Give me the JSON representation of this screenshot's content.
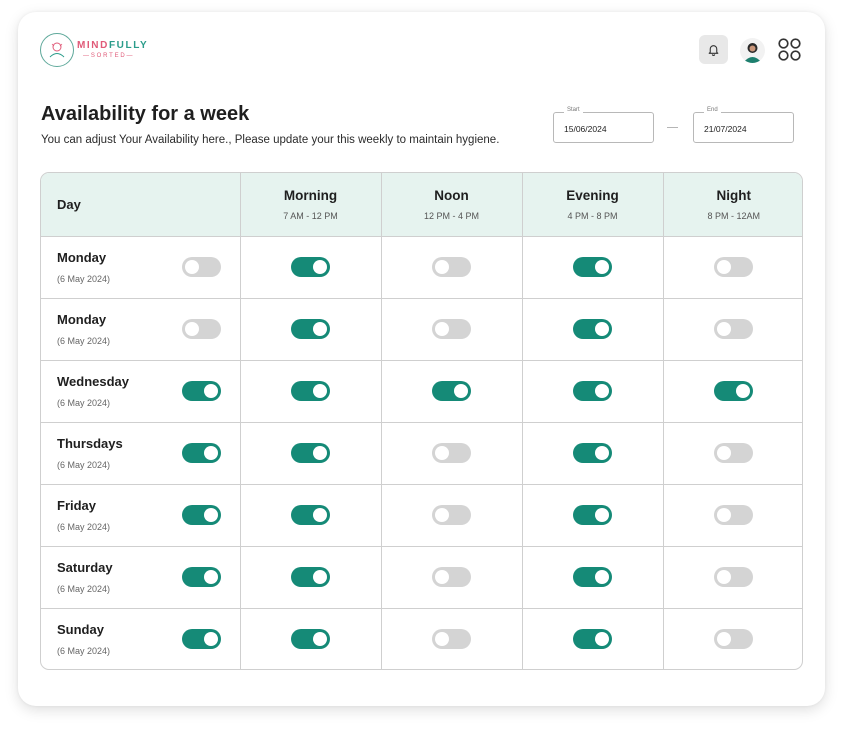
{
  "brand": {
    "name_part1": "MIND",
    "name_part2": "FULLY",
    "tagline": "SORTED"
  },
  "header": {
    "icons": [
      "bell-icon",
      "user-avatar",
      "apps-grid-icon"
    ]
  },
  "page": {
    "title": "Availability for a week",
    "subtitle": "You can adjust Your Availability here., Please update your this weekly to maintain hygiene."
  },
  "date_range": {
    "start_label": "Start",
    "start_value": "15/06/2024",
    "end_label": "End",
    "end_value": "21/07/2024"
  },
  "table": {
    "day_header": "Day",
    "slots": [
      {
        "name": "Morning",
        "time": "7 AM - 12 PM"
      },
      {
        "name": "Noon",
        "time": "12 PM - 4 PM"
      },
      {
        "name": "Evening",
        "time": "4 PM - 8 PM"
      },
      {
        "name": "Night",
        "time": "8 PM - 12AM"
      }
    ],
    "rows": [
      {
        "day": "Monday",
        "date": "(6 May 2024)",
        "day_on": false,
        "slots_on": [
          true,
          false,
          true,
          false
        ]
      },
      {
        "day": "Monday",
        "date": "(6 May 2024)",
        "day_on": false,
        "slots_on": [
          true,
          false,
          true,
          false
        ]
      },
      {
        "day": "Wednesday",
        "date": "(6 May 2024)",
        "day_on": true,
        "slots_on": [
          true,
          true,
          true,
          true
        ]
      },
      {
        "day": "Thursdays",
        "date": "(6 May 2024)",
        "day_on": true,
        "slots_on": [
          true,
          false,
          true,
          false
        ]
      },
      {
        "day": "Friday",
        "date": "(6 May 2024)",
        "day_on": true,
        "slots_on": [
          true,
          false,
          true,
          false
        ]
      },
      {
        "day": "Saturday",
        "date": "(6 May 2024)",
        "day_on": true,
        "slots_on": [
          true,
          false,
          true,
          false
        ]
      },
      {
        "day": "Sunday",
        "date": "(6 May 2024)",
        "day_on": true,
        "slots_on": [
          true,
          false,
          true,
          false
        ]
      }
    ]
  },
  "colors": {
    "accent": "#158a77",
    "toggle_off": "#d4d4d4",
    "header_bg": "#e6f3ef",
    "brand_pink": "#e05a78",
    "brand_teal": "#2a9c8a"
  }
}
